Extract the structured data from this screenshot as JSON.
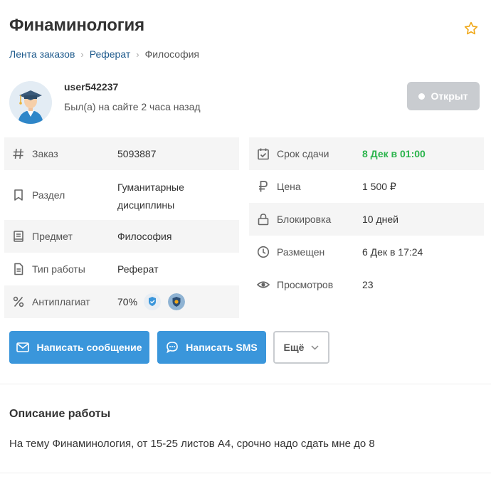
{
  "header": {
    "title": "Финаминология"
  },
  "breadcrumb": {
    "items": [
      "Лента заказов",
      "Реферат",
      "Философия"
    ]
  },
  "user": {
    "name": "user542237",
    "last_seen": "Был(а) на сайте 2 часа назад"
  },
  "status": {
    "label": "Открыт"
  },
  "details_left": [
    {
      "icon": "hash-icon",
      "label": "Заказ",
      "value": "5093887"
    },
    {
      "icon": "bookmark-icon",
      "label": "Раздел",
      "value_line1": "Гуманитарные",
      "value_line2": "дисциплины"
    },
    {
      "icon": "book-icon",
      "label": "Предмет",
      "value": "Философия"
    },
    {
      "icon": "document-icon",
      "label": "Тип работы",
      "value": "Реферат"
    },
    {
      "icon": "percent-icon",
      "label": "Антиплагиат",
      "value": "70%"
    }
  ],
  "details_right": [
    {
      "icon": "calendar-check-icon",
      "label": "Срок сдачи",
      "value": "8 Дек в 01:00"
    },
    {
      "icon": "ruble-icon",
      "label": "Цена",
      "value": "1 500 ₽"
    },
    {
      "icon": "lock-icon",
      "label": "Блокировка",
      "value": "10 дней"
    },
    {
      "icon": "clock-icon",
      "label": "Размещен",
      "value": "6 Дек в 17:24"
    },
    {
      "icon": "eye-icon",
      "label": "Просмотров",
      "value": "23"
    }
  ],
  "actions": {
    "message_label": "Написать сообщение",
    "sms_label": "Написать SMS",
    "more_label": "Ещё"
  },
  "description": {
    "title": "Описание работы",
    "text": "На тему Финаминология, от 15-25 листов А4, срочно надо сдать мне до 8"
  },
  "colors": {
    "accent": "#3a96db",
    "link": "#1e5a8c",
    "deadline": "#2bb44c",
    "status_bg": "#c9ccd0"
  }
}
